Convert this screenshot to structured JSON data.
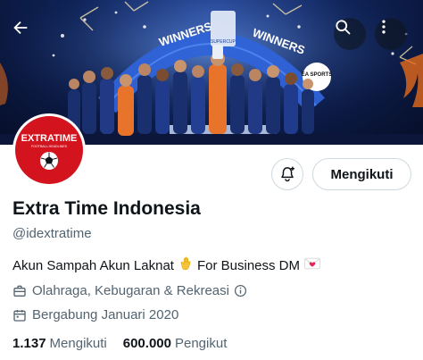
{
  "banner": {
    "winners_text_left": "WINNERS",
    "winners_text_right": "WINNERS",
    "cup_label": "SUPERCUP",
    "sponsor_label": "EA SPORTS"
  },
  "avatar": {
    "logo_text": "EXTRATIME",
    "logo_subtext": "FOOTBALL HEADLINES"
  },
  "actions": {
    "follow_label": "Mengikuti"
  },
  "profile": {
    "name": "Extra Time Indonesia",
    "handle": "@idextratime",
    "bio_part1": "Akun Sampah Akun Laknat",
    "bio_part2": "For Business DM",
    "category": "Olahraga, Kebugaran & Rekreasi",
    "joined": "Bergabung Januari 2020"
  },
  "stats": {
    "following_count": "1.137",
    "following_label": "Mengikuti",
    "followers_count": "600.000",
    "followers_label": "Pengikut"
  },
  "icons": {
    "back": "back-arrow-icon",
    "search": "search-icon",
    "more": "more-icon",
    "bell": "bell-plus-icon",
    "briefcase": "briefcase-icon",
    "calendar": "calendar-icon",
    "info": "info-icon"
  },
  "colors": {
    "avatar_red": "#d3131e",
    "text_primary": "#0f1419",
    "text_secondary": "#536471",
    "border": "#cfd9de"
  }
}
